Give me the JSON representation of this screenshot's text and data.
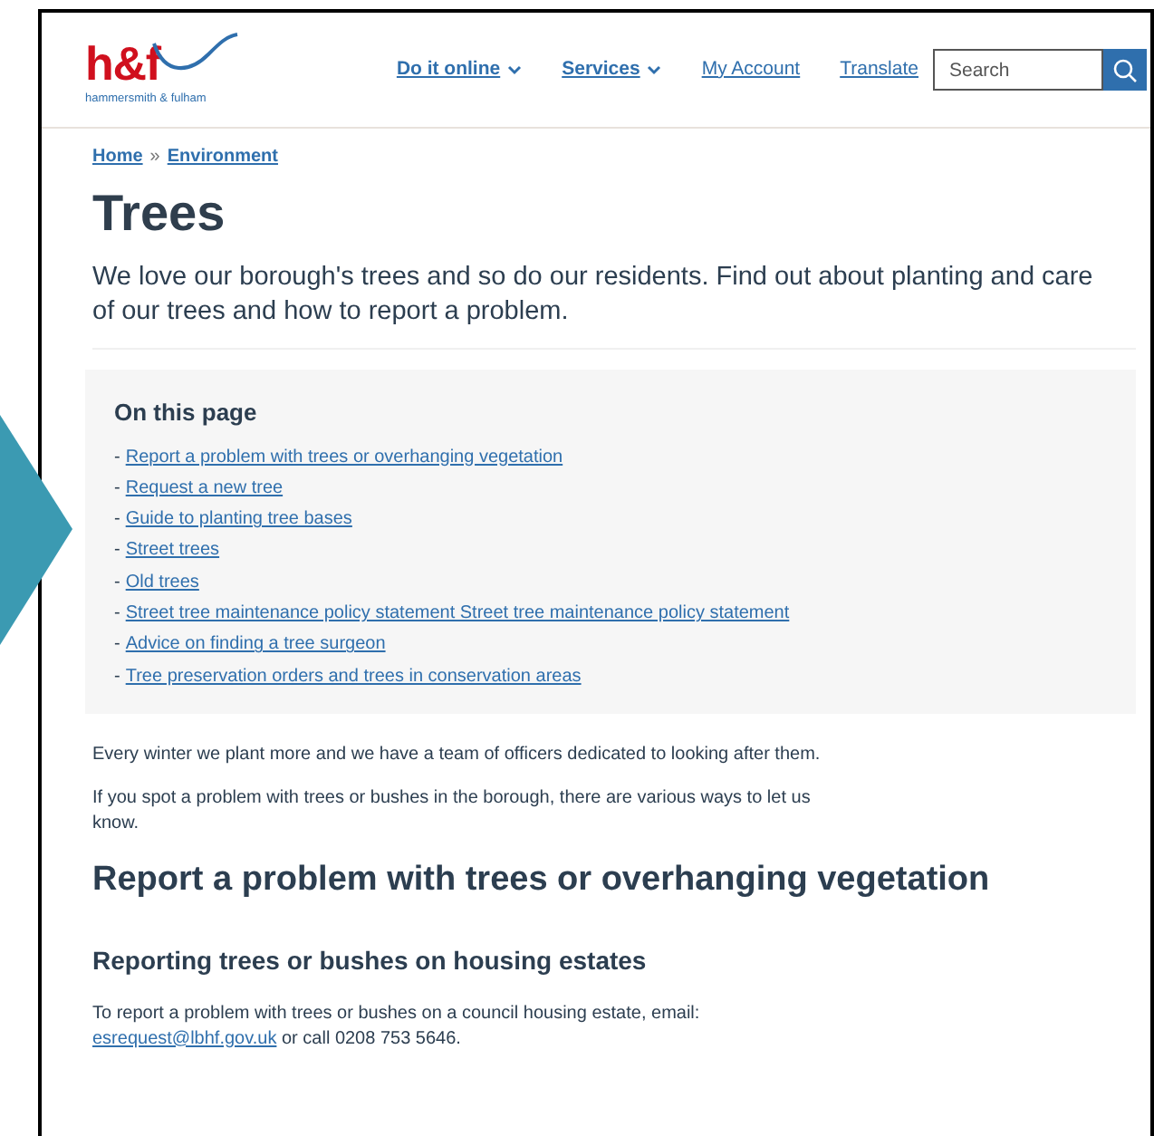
{
  "logo": {
    "mark": "h&f",
    "name": "hammersmith & fulham"
  },
  "nav": [
    {
      "label": "Do it online",
      "dropdown": true
    },
    {
      "label": "Services",
      "dropdown": true
    },
    {
      "label": "My Account",
      "dropdown": false
    },
    {
      "label": "Translate",
      "dropdown": false
    }
  ],
  "search": {
    "placeholder": "Search"
  },
  "breadcrumb": [
    {
      "label": "Home"
    },
    {
      "label": "Environment"
    }
  ],
  "breadcrumb_separator": "»",
  "title": "Trees",
  "intro": "We love our borough's trees and so do our residents. Find out about planting and care of our trees and how to report a problem.",
  "on_this_page": {
    "heading": "On this page",
    "bullet": "-",
    "links": [
      "Report a problem with trees or overhanging vegetation",
      "Request a new tree",
      "Guide to planting tree bases",
      "Street trees",
      "Old trees",
      "Street tree maintenance policy statement Street tree maintenance policy statement",
      "Advice on finding a tree surgeon",
      "Tree preservation orders and trees in conservation areas"
    ]
  },
  "paragraphs": [
    "Every winter we plant more and we have a team of officers dedicated to looking after them.",
    "If you spot a problem with trees or bushes in the borough, there are various ways to let us know."
  ],
  "section_heading": "Report a problem with trees or overhanging vegetation",
  "subheading": "Reporting trees or bushes on housing estates",
  "contact": {
    "text": "To report a problem with trees or bushes on a council housing estate, email:",
    "email": "esrequest@lbhf.gov.uk",
    "after": "or call 0208 753 5646."
  }
}
